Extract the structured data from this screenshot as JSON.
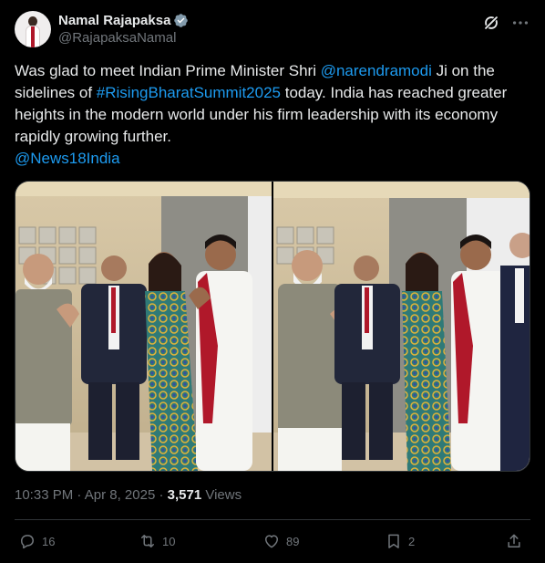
{
  "author": {
    "display_name": "Namal Rajapaksa",
    "handle": "@RajapaksaNamal",
    "verified": true
  },
  "tweet": {
    "text_1": "Was glad to meet Indian Prime Minister Shri ",
    "mention_1": "@narendramodi",
    "text_2": " Ji on the sidelines of ",
    "hashtag_1": "#RisingBharatSummit2025",
    "text_3": " today. India has reached greater heights in the modern world under his firm leadership with its economy rapidly growing further.",
    "mention_2": "@News18India"
  },
  "media": {
    "photos": [
      "photo-1",
      "photo-2"
    ]
  },
  "meta": {
    "time": "10:33 PM",
    "separator_1": " · ",
    "date": "Apr 8, 2025",
    "separator_2": " · ",
    "views_count": "3,571",
    "views_label": " Views"
  },
  "actions": {
    "replies": "16",
    "reposts": "10",
    "likes": "89",
    "bookmarks": "2"
  },
  "colors": {
    "background": "#000000",
    "text": "#e7e9ea",
    "muted": "#71767b",
    "link": "#1d9bf0",
    "verified": "#829aab",
    "border": "#2f3336"
  },
  "icons": {
    "verified": "verified-badge-icon",
    "grok": "grok-icon",
    "more": "more-icon",
    "reply": "reply-icon",
    "repost": "repost-icon",
    "like": "like-icon",
    "bookmark": "bookmark-icon",
    "share": "share-icon"
  }
}
